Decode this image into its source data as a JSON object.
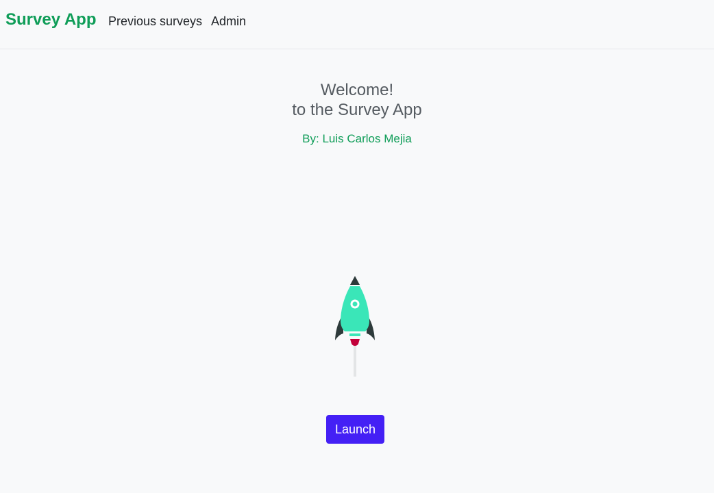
{
  "navbar": {
    "brand": "Survey App",
    "links": [
      {
        "label": "Previous surveys"
      },
      {
        "label": "Admin"
      }
    ]
  },
  "hero": {
    "welcome_line1": "Welcome!",
    "welcome_line2": "to the Survey App",
    "author": "By: Luis Carlos Mejia"
  },
  "illustration": {
    "icon": "rocket-icon",
    "colors": {
      "body": "#3ae6b8",
      "dark": "#2d3a3a",
      "flame": "#c2003a",
      "trail": "#e3e5e6"
    }
  },
  "actions": {
    "launch_label": "Launch"
  },
  "colors": {
    "brand": "#0f9d58",
    "primary_button": "#4420f5",
    "background": "#f8f9fa"
  }
}
